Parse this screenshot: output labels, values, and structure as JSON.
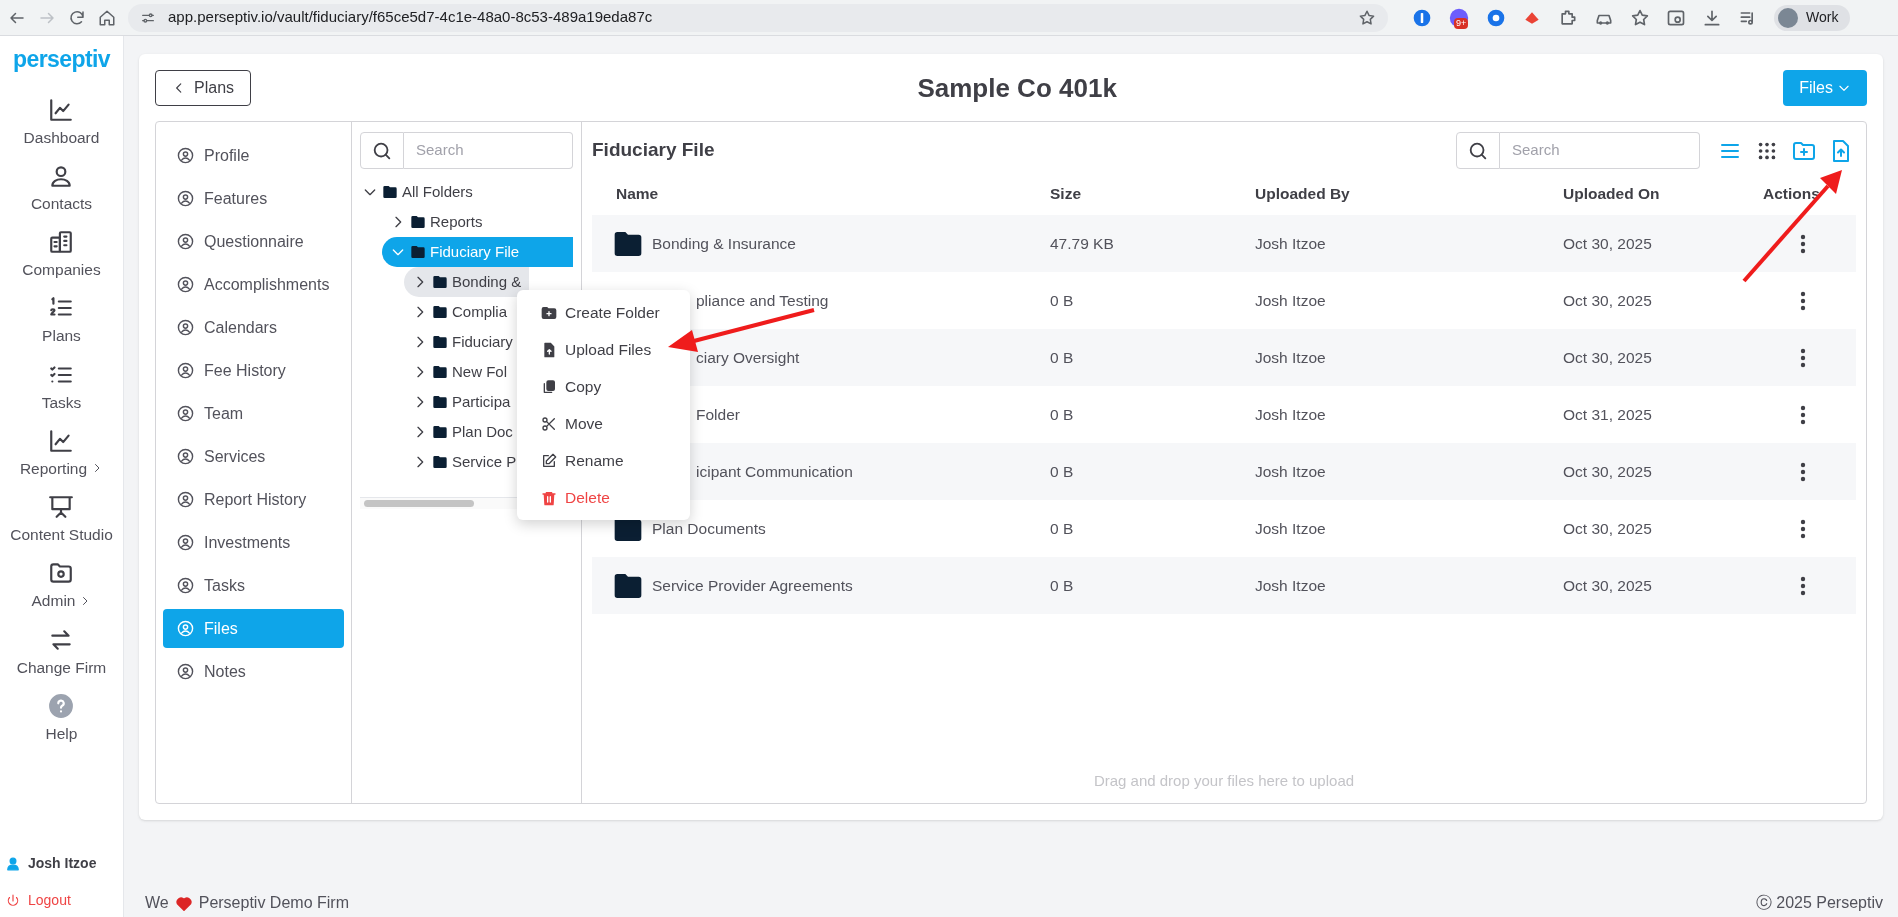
{
  "browser": {
    "url": "app.perseptiv.io/vault/fiduciary/f65ce5d7-4c1e-48a0-8c53-489a19eda87c",
    "badge": "9+",
    "profile": "Work"
  },
  "nav": {
    "logo": "perseptiv",
    "items": [
      {
        "label": "Dashboard",
        "submenu": false
      },
      {
        "label": "Contacts",
        "submenu": false
      },
      {
        "label": "Companies",
        "submenu": false
      },
      {
        "label": "Plans",
        "submenu": false
      },
      {
        "label": "Tasks",
        "submenu": false
      },
      {
        "label": "Reporting",
        "submenu": true
      },
      {
        "label": "Content Studio",
        "submenu": false
      },
      {
        "label": "Admin",
        "submenu": true
      },
      {
        "label": "Change Firm",
        "submenu": false
      },
      {
        "label": "Help",
        "submenu": false
      }
    ]
  },
  "user": {
    "name": "Josh Itzoe",
    "logout": "Logout"
  },
  "header": {
    "back": "Plans",
    "title": "Sample Co 401k",
    "menu": "Files"
  },
  "menu": {
    "items": [
      {
        "label": "Profile",
        "selected": false
      },
      {
        "label": "Features",
        "selected": false
      },
      {
        "label": "Questionnaire",
        "selected": false
      },
      {
        "label": "Accomplishments",
        "selected": false
      },
      {
        "label": "Calendars",
        "selected": false
      },
      {
        "label": "Fee History",
        "selected": false
      },
      {
        "label": "Team",
        "selected": false
      },
      {
        "label": "Services",
        "selected": false
      },
      {
        "label": "Report History",
        "selected": false
      },
      {
        "label": "Investments",
        "selected": false
      },
      {
        "label": "Tasks",
        "selected": false
      },
      {
        "label": "Files",
        "selected": true
      },
      {
        "label": "Notes",
        "selected": false
      }
    ]
  },
  "tree": {
    "placeholder": "Search",
    "nodes": [
      {
        "label": "All Folders",
        "expanded": true,
        "selected": false,
        "highlighted": false,
        "children": [
          {
            "label": "Reports",
            "expanded": false,
            "selected": false,
            "highlighted": false
          },
          {
            "label": "Fiduciary File",
            "expanded": true,
            "selected": true,
            "highlighted": false,
            "children": [
              {
                "label": "Bonding &",
                "expanded": false,
                "selected": false,
                "highlighted": true
              },
              {
                "label": "Complia",
                "expanded": false,
                "selected": false,
                "highlighted": false
              },
              {
                "label": "Fiduciary",
                "expanded": false,
                "selected": false,
                "highlighted": false
              },
              {
                "label": "New Fol",
                "expanded": false,
                "selected": false,
                "highlighted": false
              },
              {
                "label": "Participa",
                "expanded": false,
                "selected": false,
                "highlighted": false
              },
              {
                "label": "Plan Doc",
                "expanded": false,
                "selected": false,
                "highlighted": false
              },
              {
                "label": "Service P",
                "expanded": false,
                "selected": false,
                "highlighted": false
              }
            ]
          }
        ]
      }
    ]
  },
  "files": {
    "title": "Fiduciary File",
    "placeholder": "Search",
    "columns": [
      "Name",
      "Size",
      "Uploaded By",
      "Uploaded On",
      "Actions"
    ],
    "rows": [
      {
        "name": "Bonding & Insurance",
        "covered": false,
        "size": "47.79 KB",
        "uploaded_by": "Josh Itzoe",
        "uploaded_on": "Oct 30, 2025"
      },
      {
        "name": "pliance and Testing",
        "covered": true,
        "size": "0 B",
        "uploaded_by": "Josh Itzoe",
        "uploaded_on": "Oct 30, 2025"
      },
      {
        "name": "ciary Oversight",
        "covered": true,
        "size": "0 B",
        "uploaded_by": "Josh Itzoe",
        "uploaded_on": "Oct 30, 2025"
      },
      {
        "name": "Folder",
        "covered": true,
        "size": "0 B",
        "uploaded_by": "Josh Itzoe",
        "uploaded_on": "Oct 31, 2025"
      },
      {
        "name": "icipant Communication",
        "covered": true,
        "size": "0 B",
        "uploaded_by": "Josh Itzoe",
        "uploaded_on": "Oct 30, 2025"
      },
      {
        "name": "Plan Documents",
        "covered": false,
        "size": "0 B",
        "uploaded_by": "Josh Itzoe",
        "uploaded_on": "Oct 30, 2025"
      },
      {
        "name": "Service Provider Agreements",
        "covered": false,
        "size": "0 B",
        "uploaded_by": "Josh Itzoe",
        "uploaded_on": "Oct 30, 2025"
      }
    ],
    "drop_hint": "Drag and drop your files here to upload"
  },
  "context_menu": {
    "items": [
      {
        "label": "Create Folder",
        "kind": "normal"
      },
      {
        "label": "Upload Files",
        "kind": "normal"
      },
      {
        "label": "Copy",
        "kind": "normal"
      },
      {
        "label": "Move",
        "kind": "normal"
      },
      {
        "label": "Rename",
        "kind": "normal"
      },
      {
        "label": "Delete",
        "kind": "danger"
      }
    ]
  },
  "footer": {
    "prefix": "We",
    "firm": "Perseptiv Demo Firm",
    "copyright": "ⓒ 2025 Perseptiv"
  }
}
